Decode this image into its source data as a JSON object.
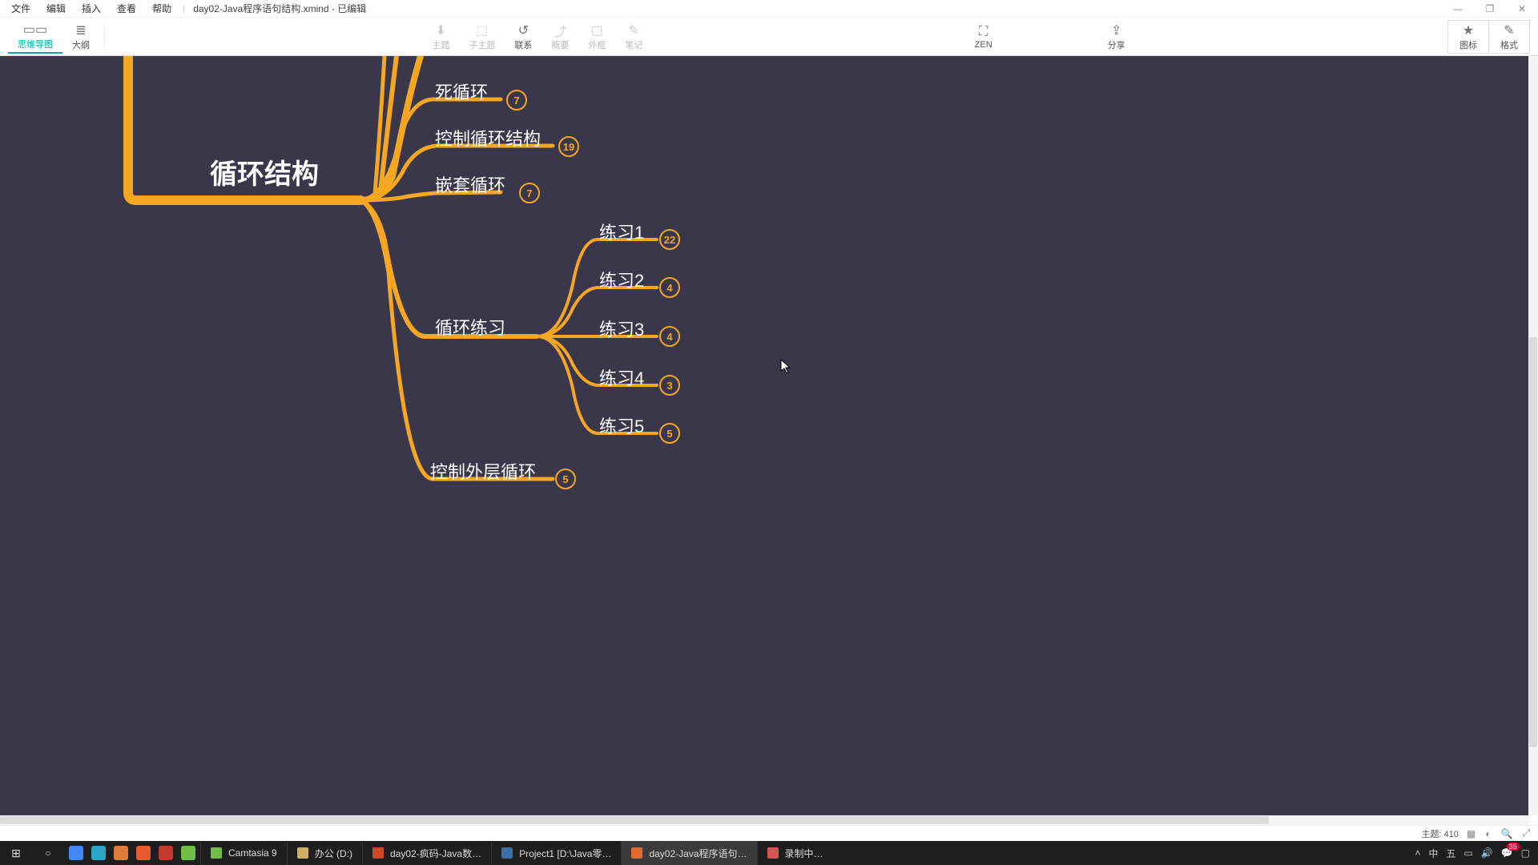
{
  "window": {
    "title_file": "day02-Java程序语句结构.xmind",
    "title_status": "已编辑",
    "menu": [
      "文件",
      "编辑",
      "插入",
      "查看",
      "帮助"
    ],
    "controls": {
      "min": "—",
      "max": "❐",
      "close": "✕"
    }
  },
  "toolbar": {
    "left": [
      {
        "icon": "▭▭",
        "label": "思维导图",
        "active": true
      },
      {
        "icon": "≣",
        "label": "大纲"
      }
    ],
    "center": [
      {
        "icon": "⬇",
        "label": "主题",
        "disabled": true
      },
      {
        "icon": "⬚",
        "label": "子主题",
        "disabled": true
      },
      {
        "icon": "↺",
        "label": "联系"
      },
      {
        "icon": "⤴",
        "label": "概要",
        "disabled": true
      },
      {
        "icon": "▢",
        "label": "外框",
        "disabled": true
      },
      {
        "icon": "✎",
        "label": "笔记",
        "disabled": true
      }
    ],
    "zen": {
      "icon": "⛶",
      "label": "ZEN"
    },
    "share": {
      "icon": "⇪",
      "label": "分享"
    },
    "right": [
      {
        "icon": "★",
        "label": "图标"
      },
      {
        "icon": "✎",
        "label": "格式"
      }
    ]
  },
  "mindmap": {
    "root": "循环结构",
    "branches": [
      {
        "label": "死循环",
        "count": 7
      },
      {
        "label": "控制循环结构",
        "count": 19
      },
      {
        "label": "嵌套循环",
        "count": 7
      },
      {
        "label": "循环练习",
        "children": [
          {
            "label": "练习1",
            "count": 22
          },
          {
            "label": "练习2",
            "count": 4
          },
          {
            "label": "练习3",
            "count": 4
          },
          {
            "label": "练习4",
            "count": 3
          },
          {
            "label": "练习5",
            "count": 5
          }
        ]
      },
      {
        "label": "控制外层循环",
        "count": 5
      }
    ],
    "colors": {
      "stroke": "#f5a623",
      "bg": "#3a374b"
    }
  },
  "statusbar": {
    "topic_count_label": "主题:",
    "topic_count": "410"
  },
  "taskbar": {
    "apps": [
      {
        "label": "Camtasia 9",
        "color": "#6fbf44"
      },
      {
        "label": "办公 (D:)",
        "color": "#d0b060"
      },
      {
        "label": "day02-疯码-Java数…",
        "color": "#d24726"
      },
      {
        "label": "Project1 [D:\\Java零…",
        "color": "#3a6fa5"
      },
      {
        "label": "day02-Java程序语句…",
        "color": "#e26a2c",
        "active": true
      },
      {
        "label": "录制中…",
        "color": "#d9534f"
      }
    ],
    "tray": {
      "notif": "35",
      "ime1": "中",
      "ime2": "五"
    }
  }
}
